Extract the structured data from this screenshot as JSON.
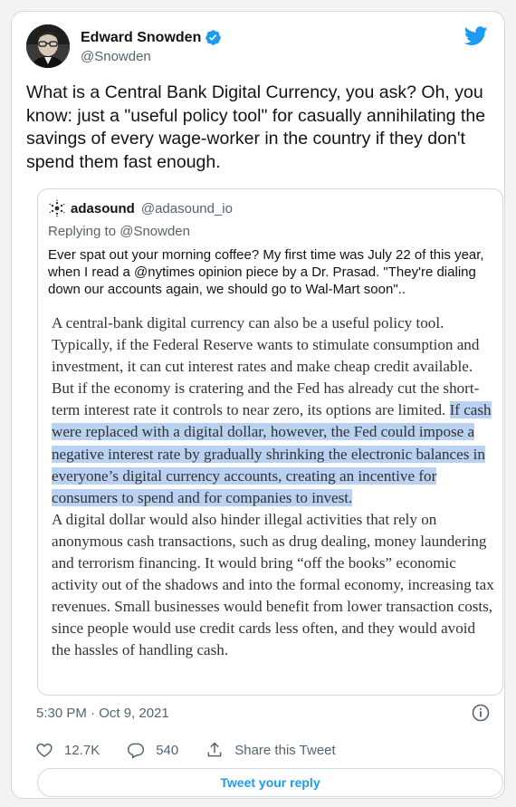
{
  "tweet": {
    "author_name": "Edward Snowden",
    "author_handle": "@Snowden",
    "text": "What is a Central Bank Digital Currency, you ask? Oh, you know: just a \"useful policy tool\" for casually annihilating the savings of every wage-worker in the country if they don't spend them fast enough.",
    "timestamp": "5:30 PM · Oct 9, 2021",
    "verified_icon": "verified-badge-icon",
    "brand_color": "#1d9bf0"
  },
  "quote": {
    "author_name": "adasound",
    "author_handle": "@adasound_io",
    "replying_prefix": "Replying to ",
    "replying_to": "@Snowden",
    "text": "Ever spat out your morning coffee?  My first time was July 22 of this year, when I read a @nytimes opinion piece by a Dr. Prasad.  \"They're dialing down our accounts again, we should go to Wal-Mart soon\"..",
    "article": {
      "p1_before": "A central-bank digital currency can also be a useful policy tool. Typically, if the Federal Reserve wants to stimulate consumption and investment, it can cut interest rates and make cheap credit available. But if the economy is cratering and the Fed has already cut the short-term interest rate it controls to near zero, its options are limited. ",
      "p1_highlight": "If cash were replaced with a digital dollar, however, the Fed could impose a negative interest rate by gradually shrinking the electronic balances in everyone’s digital currency accounts, creating an incentive for consumers to spend and for companies to invest.",
      "p2": "A digital dollar would also hinder illegal activities that rely on anonymous cash transactions, such as drug dealing, money laundering and terrorism financing. It would bring “off the books” economic activity out of the shadows and into the formal economy, increasing tax revenues. Small businesses would benefit from lower transaction costs, since people would use credit cards less often, and they would avoid the hassles of handling cash.",
      "highlight_color": "#b9d2f1"
    }
  },
  "actions": {
    "likes": "12.7K",
    "replies": "540",
    "share_label": "Share this Tweet"
  },
  "reply_button": "Tweet your reply"
}
